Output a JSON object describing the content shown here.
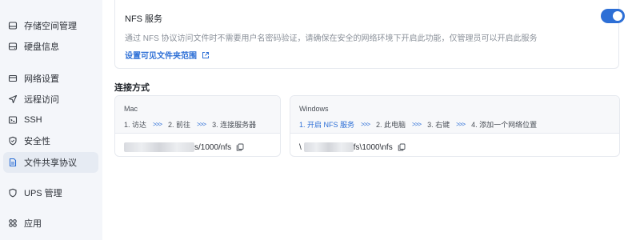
{
  "sidebar": {
    "items": [
      {
        "label": "存储空间管理",
        "icon": "storage-icon"
      },
      {
        "label": "硬盘信息",
        "icon": "disk-icon"
      },
      {
        "label": "网络设置",
        "icon": "network-icon"
      },
      {
        "label": "远程访问",
        "icon": "remote-icon"
      },
      {
        "label": "SSH",
        "icon": "ssh-icon"
      },
      {
        "label": "安全性",
        "icon": "shield-icon"
      },
      {
        "label": "文件共享协议",
        "icon": "file-share-icon"
      },
      {
        "label": "UPS 管理",
        "icon": "ups-icon"
      },
      {
        "label": "应用",
        "icon": "apps-icon"
      }
    ],
    "active": "文件共享协议"
  },
  "nfs": {
    "title": "NFS 服务",
    "enabled": true,
    "description": "通过 NFS 协议访问文件时不需要用户名密码验证，请确保在安全的网络环境下开启此功能，仅管理员可以开启此服务",
    "link": "设置可见文件夹范围"
  },
  "connection": {
    "title": "连接方式",
    "mac": {
      "name": "Mac",
      "steps": [
        "1. 访达",
        "2. 前往",
        "3. 连接服务器"
      ],
      "path_suffix": "s/1000/nfs"
    },
    "windows": {
      "name": "Windows",
      "steps": [
        "1. 开启 NFS 服务",
        "2. 此电脑",
        "3. 右键",
        "4. 添加一个网络位置"
      ],
      "path_prefix": "\\",
      "path_suffix": "fs\\1000\\nfs"
    }
  },
  "colors": {
    "accent": "#2d6fd6",
    "sidebar_bg": "#f4f6fa",
    "active_bg": "#e6ebf3"
  }
}
